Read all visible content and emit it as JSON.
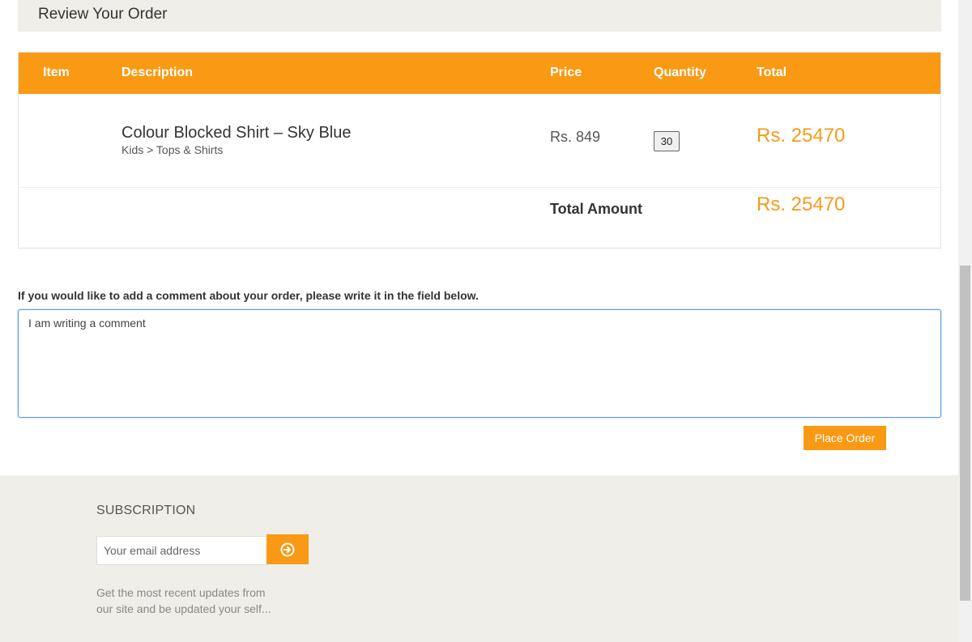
{
  "review": {
    "title": "Review Your Order"
  },
  "table": {
    "headers": {
      "item": "Item",
      "description": "Description",
      "price": "Price",
      "quantity": "Quantity",
      "total": "Total"
    },
    "row": {
      "name": "Colour Blocked Shirt – Sky Blue",
      "category": "Kids > Tops & Shirts",
      "price": "Rs. 849",
      "quantity": "30",
      "total": "Rs. 25470"
    },
    "summary": {
      "label": "Total Amount",
      "value": "Rs. 25470"
    }
  },
  "comment": {
    "label": "If you would like to add a comment about your order, please write it in the field below.",
    "value": "I am writing a comment"
  },
  "actions": {
    "place_order": "Place Order"
  },
  "footer": {
    "subscription_title": "SUBSCRIPTION",
    "email_placeholder": "Your email address",
    "submit_icon": "arrow-circle-right-icon",
    "description": "Get the most recent updates from our site and be updated your self..."
  },
  "colors": {
    "accent": "#fa9913",
    "price_accent": "#f39b1b",
    "footer_bg": "#efeee9"
  }
}
